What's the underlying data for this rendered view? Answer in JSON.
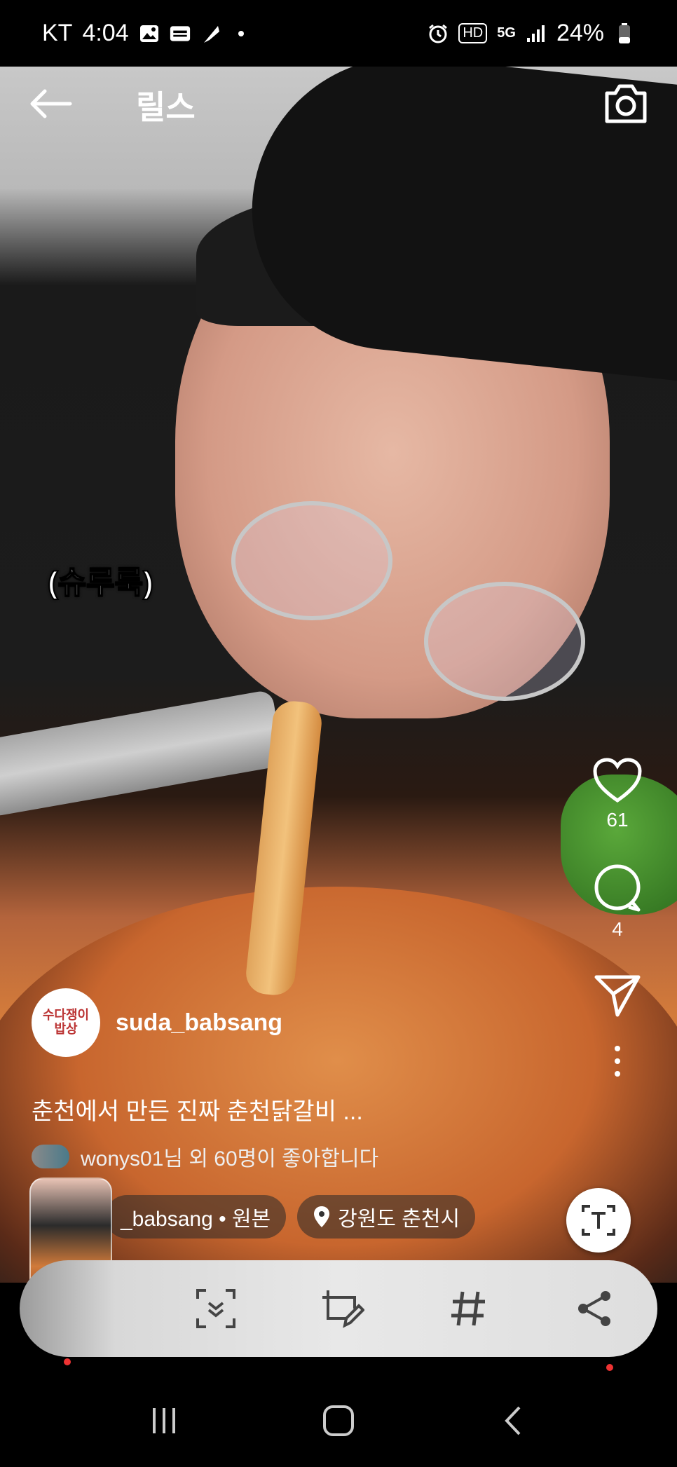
{
  "status_bar": {
    "carrier": "KT",
    "time": "4:04",
    "network": "5G",
    "hd_badge": "HD",
    "battery": "24%"
  },
  "header": {
    "title": "릴스",
    "back_icon": "arrow-left-icon",
    "camera_icon": "camera-icon"
  },
  "video": {
    "subtitle": "(슈루룩)"
  },
  "actions": {
    "like_count": "61",
    "comment_count": "4"
  },
  "post": {
    "username": "suda_babsang",
    "avatar_text": "수다쟁이 밥상",
    "caption": "춘천에서 만든 진짜 춘천닭갈비 ...",
    "likes_text": "wonys01님 외 60명이 좋아합니다",
    "audio_chip": "_babsang • 원본",
    "location_chip": "강원도 춘천시"
  },
  "toolbar": {
    "items": [
      "scan-icon",
      "edit-crop-icon",
      "hashtag-icon",
      "share-icon"
    ]
  },
  "colors": {
    "accent_red": "#e33333",
    "toolbar_bg": "#e4e4e4"
  }
}
